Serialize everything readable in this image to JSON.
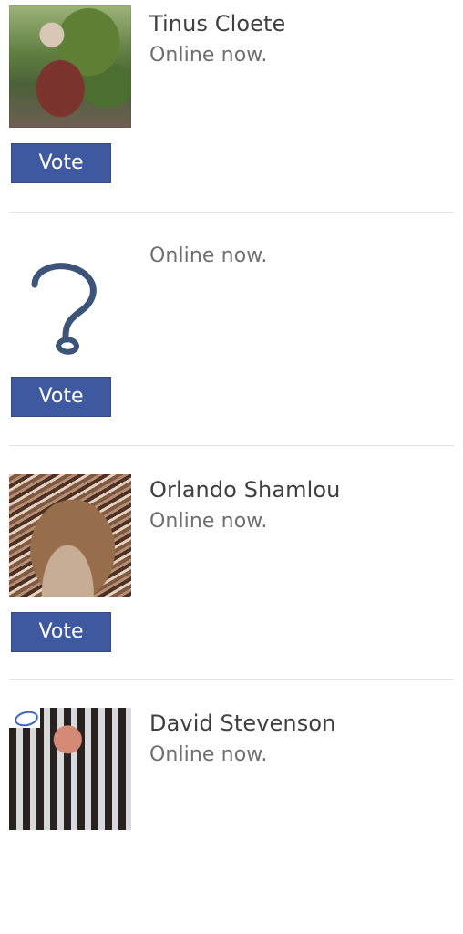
{
  "people": [
    {
      "name": "Tinus Cloete",
      "status": "Online now.",
      "vote_label": "Vote",
      "avatar": "photo"
    },
    {
      "name": "",
      "status": "Online now.",
      "vote_label": "Vote",
      "avatar": "question-mark-placeholder-icon"
    },
    {
      "name": "Orlando Shamlou",
      "status": "Online now.",
      "vote_label": "Vote",
      "avatar": "photo"
    },
    {
      "name": "David Stevenson",
      "status": "Online now.",
      "avatar": "photo"
    }
  ],
  "colors": {
    "vote_button": "#3f59a0",
    "divider": "#e3e3e3",
    "name_text": "#404040",
    "status_text": "#6f6f6f"
  }
}
